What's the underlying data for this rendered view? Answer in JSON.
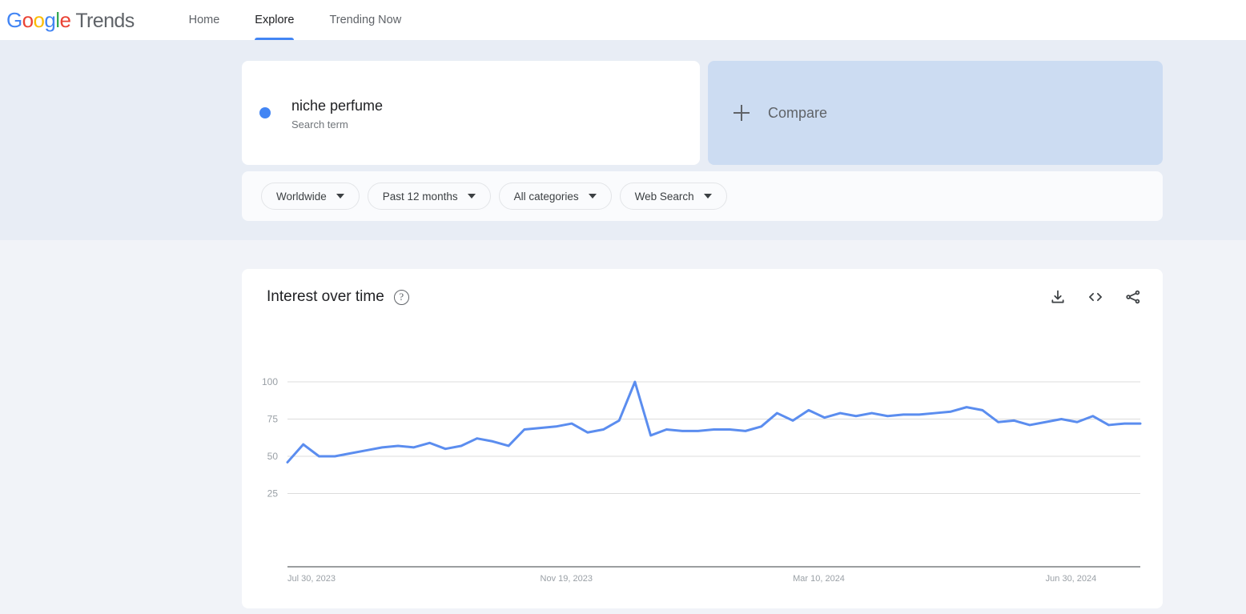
{
  "header": {
    "logo": {
      "word": "Google",
      "product": "Trends"
    },
    "nav": [
      {
        "label": "Home",
        "active": false
      },
      {
        "label": "Explore",
        "active": true
      },
      {
        "label": "Trending Now",
        "active": false
      }
    ]
  },
  "query": {
    "term": {
      "name": "niche perfume",
      "type_label": "Search term",
      "color": "#4285F4"
    },
    "compare": {
      "label": "Compare",
      "icon": "plus-icon"
    }
  },
  "filters": [
    {
      "name": "location",
      "label": "Worldwide"
    },
    {
      "name": "time-range",
      "label": "Past 12 months"
    },
    {
      "name": "category",
      "label": "All categories"
    },
    {
      "name": "search-type",
      "label": "Web Search"
    }
  ],
  "chart_card": {
    "title": "Interest over time",
    "help_icon": "help-circle-icon",
    "actions": [
      {
        "name": "download-csv-button",
        "icon": "download-icon"
      },
      {
        "name": "embed-button",
        "icon": "code-brackets-icon"
      },
      {
        "name": "share-button",
        "icon": "share-icon"
      }
    ]
  },
  "chart_data": {
    "type": "line",
    "title": "Interest over time",
    "xlabel": "",
    "ylabel": "",
    "ylim": [
      0,
      100
    ],
    "yticks": [
      25,
      50,
      75,
      100
    ],
    "grid": true,
    "legend": false,
    "line_color": "#5b8def",
    "x_tick_labels": [
      "Jul 30, 2023",
      "Nov 19, 2023",
      "Mar 10, 2024",
      "Jun 30, 2024"
    ],
    "x_tick_indices": [
      0,
      16,
      32,
      48
    ],
    "series": [
      {
        "name": "niche perfume",
        "values": [
          46,
          58,
          50,
          50,
          52,
          54,
          56,
          57,
          56,
          59,
          55,
          57,
          62,
          60,
          57,
          68,
          69,
          70,
          72,
          66,
          68,
          74,
          100,
          64,
          68,
          67,
          67,
          68,
          68,
          67,
          70,
          79,
          74,
          81,
          76,
          79,
          77,
          79,
          77,
          78,
          78,
          79,
          80,
          83,
          81,
          73,
          74,
          71,
          73,
          75,
          73,
          77,
          71,
          72,
          72
        ]
      }
    ]
  }
}
